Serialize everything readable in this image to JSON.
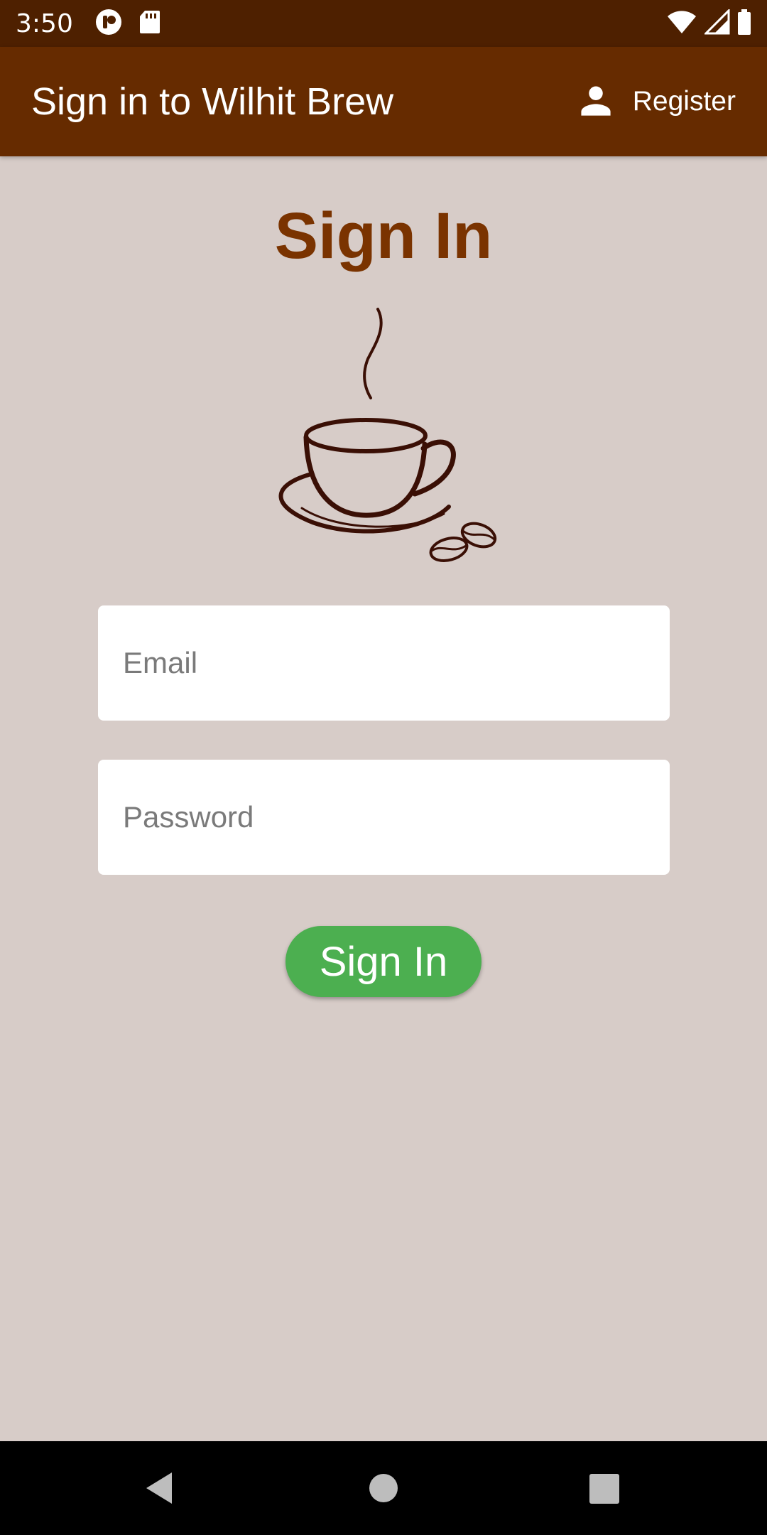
{
  "status_bar": {
    "time": "3:50",
    "icons": [
      "app-notification-icon",
      "sd-card-icon",
      "wifi-icon",
      "cell-signal-icon",
      "battery-icon"
    ]
  },
  "app_bar": {
    "title": "Sign in to Wilhit Brew",
    "register_label": "Register",
    "register_icon": "person-icon"
  },
  "form": {
    "heading": "Sign In",
    "logo_icon": "coffee-cup-icon",
    "email_placeholder": "Email",
    "password_placeholder": "Password",
    "submit_label": "Sign In"
  },
  "nav_bar": {
    "icons": [
      "back-icon",
      "home-icon",
      "recents-icon"
    ]
  },
  "colors": {
    "status_bar": "#4e2000",
    "app_bar": "#662b00",
    "background": "#d7ccc8",
    "heading": "#7a3300",
    "button": "#4caf50",
    "logo_stroke": "#3a0f05"
  }
}
